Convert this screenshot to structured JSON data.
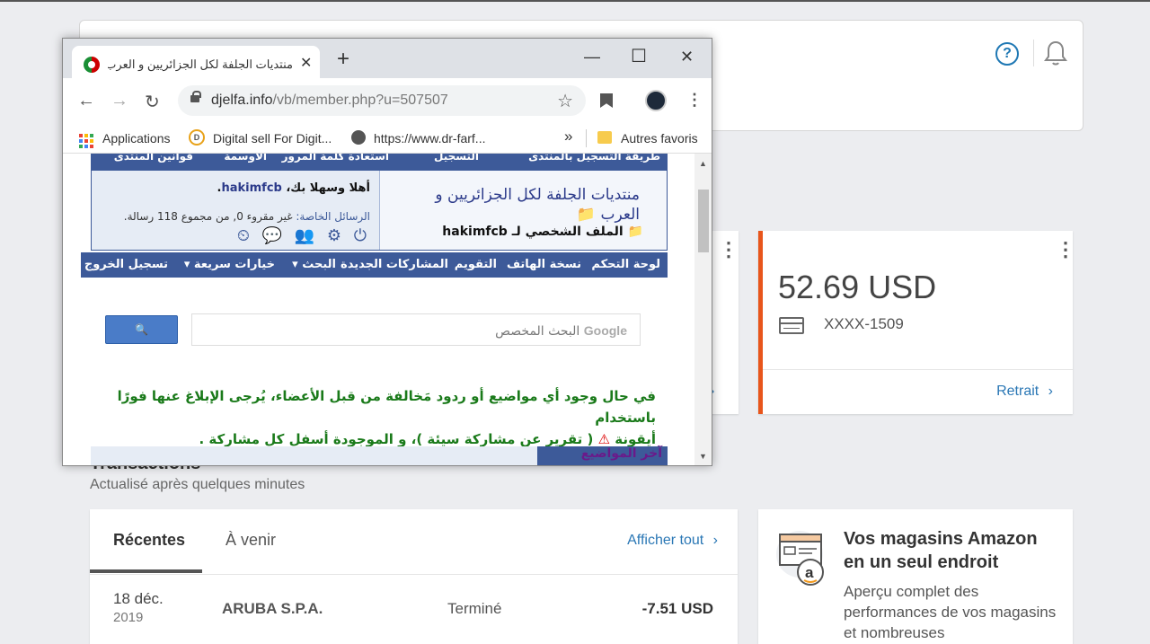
{
  "header": {
    "help_icon": "question-circle-icon",
    "bell_icon": "bell-icon"
  },
  "balance_card": {
    "amount": "52.69 USD",
    "account": "XXXX-1509",
    "action": "Retrait",
    "chevron": "›",
    "more": "⋮"
  },
  "left_card": {
    "more": "⋮",
    "chevron": "›"
  },
  "transactions": {
    "title": "Transactions",
    "subtitle": "Actualisé après quelques minutes",
    "tabs": [
      "Récentes",
      "À venir"
    ],
    "view_all": "Afficher tout",
    "view_all_chevron": "›",
    "rows": [
      {
        "day": "18 déc.",
        "year": "2019",
        "name": "ARUBA S.P.A.",
        "status": "Terminé",
        "amount": "-7.51 USD"
      }
    ]
  },
  "amazon": {
    "title": "Vos magasins Amazon en un seul endroit",
    "body": "Aperçu complet des performances de vos magasins et nombreuses"
  },
  "browser": {
    "tab_title": "منتديات الجلفة لكل الجزائريين و العرب",
    "tab_close": "✕",
    "new_tab": "+",
    "minimize": "—",
    "maximize": "☐",
    "close": "✕",
    "back": "←",
    "forward": "→",
    "reload": "↻",
    "url_host": "djelfa.info",
    "url_path": "/vb/member.php?u=507507",
    "star": "☆",
    "bookmarks": [
      "Applications",
      "Digital sell For Digit...",
      "https://www.dr-farf...",
      "Autres favoris"
    ],
    "bookmarks_more": "»"
  },
  "forum": {
    "top_nav": [
      "طريقة التسجيل بالمنتدى",
      "التسجيل",
      "استعادة كلمة المرور",
      "الأوسمة",
      "قوانين المنتدى"
    ],
    "title": "منتديات الجلفة لكل الجزائريين و العرب",
    "profile_prefix": "الملف الشخصي لـ",
    "username": "hakimfcb",
    "welcome_prefix": "أهلا وسهلا بك",
    "welcome_user": "hakimfcb",
    "pm_label": "الرسائل الخاصة:",
    "pm_text": "غير مقروء 0, من مجموع 118 رسالة.",
    "icons": "⏻ ⚙ 👥 💬 ⏲",
    "main_nav": [
      "لوحة التحكم",
      "نسخة الهاتف",
      "التقويم",
      "المشاركات الجديدة",
      "البحث ▾",
      "خيارات سريعة ▾",
      "تسجيل الخروج"
    ],
    "search_placeholder": "البحث المخصص",
    "search_brand": "Google",
    "search_button_icon": "🔍",
    "notice_line1": "في حال وجود أي مواضيع أو ردود مَخالفة من قبل الأعضاء، يُرجى الإبلاغ عنها فورًا باستخدام",
    "notice_line2_a": "أيقونة",
    "notice_warn": "⚠",
    "notice_line2_b": "( تقرير عن مشاركة سيئة )، و الموجودة أسفل كل مشاركة .",
    "bottom_label": "آخر المواضيع"
  }
}
